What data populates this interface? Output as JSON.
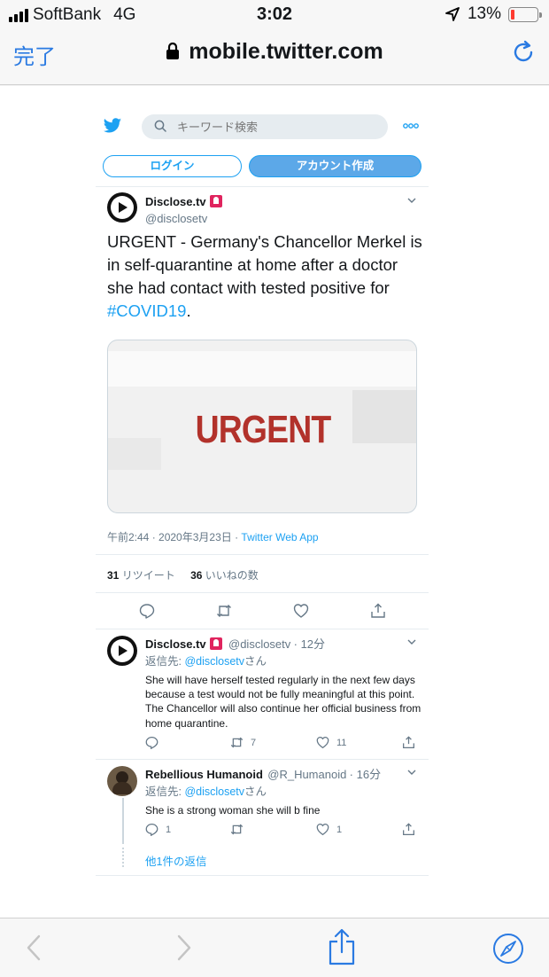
{
  "status_bar": {
    "carrier": "SoftBank",
    "network": "4G",
    "time": "3:02",
    "battery": "13%",
    "battery_level": 0.13
  },
  "browser": {
    "done_label": "完了",
    "url": "mobile.twitter.com"
  },
  "header": {
    "search_placeholder": "キーワード検索",
    "login_label": "ログイン",
    "signup_label": "アカウント作成"
  },
  "tweet": {
    "name": "Disclose.tv",
    "handle": "@disclosetv",
    "text_prefix": "URGENT - Germany's Chancellor Merkel is in self-quarantine at home after a doctor she had contact with tested positive for ",
    "hashtag": "#COVID19",
    "text_suffix": ".",
    "media_text": "URGENT",
    "timestamp": "午前2:44 · 2020年3月23日 · ",
    "source": "Twitter Web App",
    "retweets_count": "31",
    "retweets_label": "リツイート",
    "likes_count": "36",
    "likes_label": "いいねの数"
  },
  "replies": [
    {
      "name": "Disclose.tv",
      "handle": "@disclosetv",
      "time": "· 12分",
      "reply_to_label": "返信先: ",
      "reply_to_handle": "@disclosetv",
      "reply_to_suffix": "さん",
      "text": "She will have herself tested regularly in the next few days because a test would not be fully meaningful at this point. The Chancellor will also continue her official business from home quarantine.",
      "reply_count": "",
      "retweet_count": "7",
      "like_count": "11"
    },
    {
      "name": "Rebellious Humanoid",
      "handle": "@R_Humanoid",
      "time": "· 16分",
      "reply_to_label": "返信先: ",
      "reply_to_handle": "@disclosetv",
      "reply_to_suffix": "さん",
      "text": "She is a strong woman she will b fine",
      "reply_count": "1",
      "retweet_count": "",
      "like_count": "1"
    }
  ],
  "more_replies_label": "他1件の返信",
  "colors": {
    "accent": "#1da1f2",
    "ios_blue": "#2a7ae2",
    "urgent_red": "#b2322b"
  }
}
